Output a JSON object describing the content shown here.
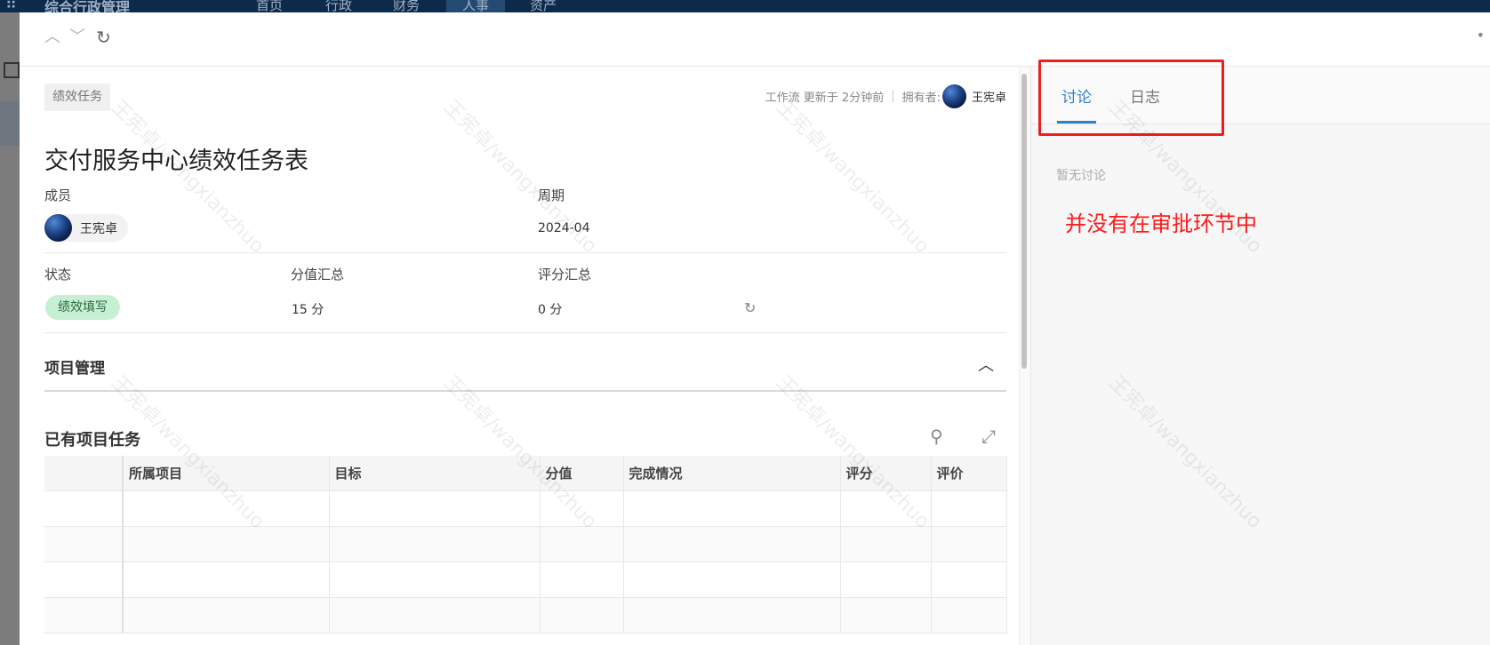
{
  "background": {
    "app_title": "综合行政管理",
    "nav": [
      "首页",
      "行政",
      "财务",
      "人事",
      "资产"
    ],
    "active_nav": "人事"
  },
  "header": {
    "prev_icon": "chevron-up-icon",
    "next_icon": "chevron-down-icon",
    "refresh_icon": "refresh-icon"
  },
  "record": {
    "tag": "绩效任务",
    "meta_workflow": "工作流 更新于 2分钟前",
    "meta_separator": "|",
    "meta_owner_label": "拥有者:",
    "owner_name": "王宪卓",
    "title": "交付服务中心绩效任务表",
    "fields": {
      "member_label": "成员",
      "member_name": "王宪卓",
      "period_label": "周期",
      "period_value": "2024-04",
      "status_label": "状态",
      "status_value": "绩效填写",
      "score_total_label": "分值汇总",
      "score_total_value": "15 分",
      "rating_total_label": "评分汇总",
      "rating_total_value": "0 分"
    },
    "section_title": "项目管理",
    "subsection_title": "已有项目任务",
    "table": {
      "columns": [
        "",
        "所属项目",
        "目标",
        "分值",
        "完成情况",
        "评分",
        "评价"
      ],
      "rows": [
        [
          "",
          "",
          "",
          "",
          "",
          "",
          ""
        ],
        [
          "",
          "",
          "",
          "",
          "",
          "",
          ""
        ],
        [
          "",
          "",
          "",
          "",
          "",
          "",
          ""
        ],
        [
          "",
          "",
          "",
          "",
          "",
          "",
          ""
        ]
      ]
    }
  },
  "side_panel": {
    "tabs": [
      "讨论",
      "日志"
    ],
    "active_tab": "讨论",
    "empty_text": "暂无讨论",
    "annotation": "并没有在审批环节中"
  },
  "watermark_text": "王宪卓/wangxianzhuo",
  "colors": {
    "accent": "#2f7fd1",
    "status_bg": "#c6efd3",
    "annotation": "#ff1a1a"
  }
}
